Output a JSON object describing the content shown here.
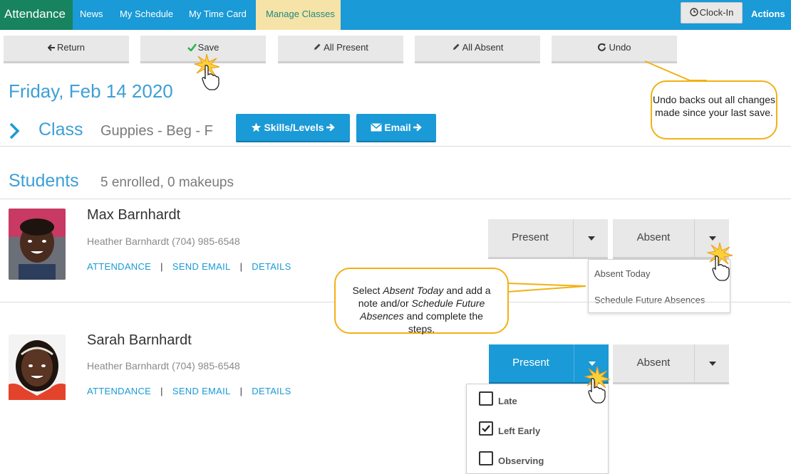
{
  "nav": {
    "brand": "Attendance",
    "links": [
      "News",
      "My Schedule",
      "My Time Card"
    ],
    "active": "Manage Classes",
    "clockin": "Clock-In",
    "actions": "Actions"
  },
  "toolbar": {
    "return": "Return",
    "save": "Save",
    "all_present": "All Present",
    "all_absent": "All Absent",
    "undo": "Undo"
  },
  "page": {
    "date": "Friday, Feb 14 2020",
    "class_label": "Class",
    "class_name": "Guppies - Beg - F",
    "skills_btn": "Skills/Levels",
    "email_btn": "Email",
    "students_heading": "Students",
    "enrolled": "5 enrolled, 0 makeups"
  },
  "students": [
    {
      "name": "Max Barnhardt",
      "contact": "Heather Barnhardt (704) 985-6548",
      "links": [
        "ATTENDANCE",
        "SEND EMAIL",
        "DETAILS"
      ],
      "present": "Present",
      "absent": "Absent"
    },
    {
      "name": "Sarah Barnhardt",
      "contact": "Heather Barnhardt (704) 985-6548",
      "links": [
        "ATTENDANCE",
        "SEND EMAIL",
        "DETAILS"
      ],
      "present": "Present",
      "absent": "Absent"
    }
  ],
  "absent_menu": [
    "Absent Today",
    "Schedule Future Absences"
  ],
  "present_menu": [
    {
      "label": "Late",
      "checked": false
    },
    {
      "label": "Left Early",
      "checked": true
    },
    {
      "label": "Observing",
      "checked": false
    }
  ],
  "callouts": {
    "undo": "Undo backs out all changes made since your last save.",
    "select_pre": "Select ",
    "select_em1": "Absent Today",
    "select_mid": " and add a note and/or ",
    "select_em2": "Schedule Future Absences",
    "select_post": " and complete the steps."
  },
  "colors": {
    "nav_blue": "#1a9ad6",
    "brand_green": "#17845f",
    "active_tab": "#f6e3a7",
    "heading_blue": "#3d9fd6",
    "callout_border": "#f1b114",
    "check_green": "#2cb34a"
  }
}
